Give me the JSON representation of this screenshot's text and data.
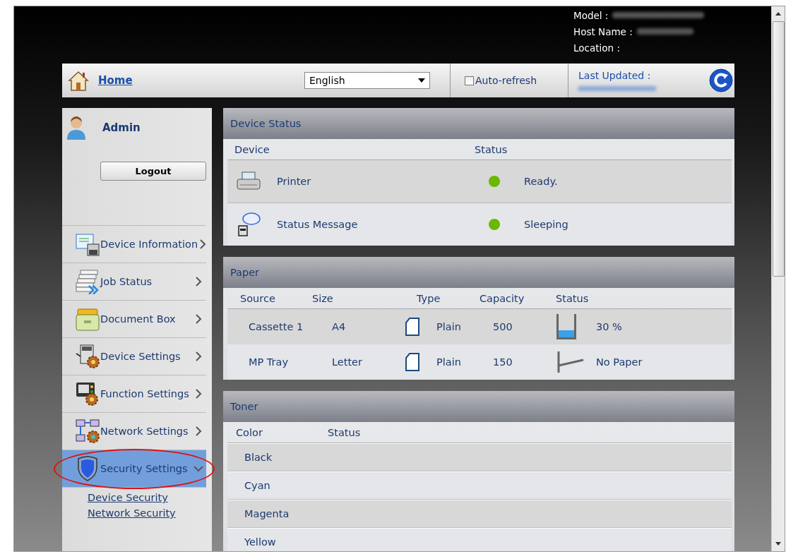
{
  "device_info": {
    "model_label": "Model :",
    "host_name_label": "Host Name :",
    "location_label": "Location :"
  },
  "toolbar": {
    "home_link": "Home",
    "language": "English",
    "auto_refresh": {
      "label": "Auto-refresh",
      "checked": false
    },
    "last_updated_label": "Last Updated :"
  },
  "sidebar": {
    "user": "Admin",
    "logout_button": "Logout",
    "items": [
      {
        "label": "Device Information",
        "kind": "info",
        "selected": false,
        "expanded": false
      },
      {
        "label": "Job Status",
        "kind": "jobs",
        "selected": false,
        "expanded": false
      },
      {
        "label": "Document Box",
        "kind": "box",
        "selected": false,
        "expanded": false
      },
      {
        "label": "Device Settings",
        "kind": "device",
        "selected": false,
        "expanded": false
      },
      {
        "label": "Function Settings",
        "kind": "function",
        "selected": false,
        "expanded": false
      },
      {
        "label": "Network Settings",
        "kind": "network",
        "selected": false,
        "expanded": false
      },
      {
        "label": "Security Settings",
        "kind": "security",
        "selected": true,
        "expanded": true
      }
    ],
    "sub_items": [
      "Device Security",
      "Network Security"
    ]
  },
  "device_status": {
    "title": "Device Status",
    "columns": [
      "Device",
      "Status"
    ],
    "rows": [
      {
        "kind": "printer",
        "device": "Printer",
        "status": "Ready.",
        "color": "#6ab800"
      },
      {
        "kind": "message",
        "device": "Status Message",
        "status": "Sleeping",
        "color": "#6ab800"
      }
    ]
  },
  "paper": {
    "title": "Paper",
    "columns": [
      "Source",
      "Size",
      "Type",
      "Capacity",
      "Status"
    ],
    "rows": [
      {
        "source": "Cassette 1",
        "size": "A4",
        "type": "Plain",
        "capacity": "500",
        "level": 0.3,
        "status": "30 %"
      },
      {
        "source": "MP Tray",
        "size": "Letter",
        "type": "Plain",
        "capacity": "150",
        "status": "No Paper"
      }
    ]
  },
  "toner": {
    "title": "Toner",
    "columns": [
      "Color",
      "Status"
    ],
    "rows": [
      "Black",
      "Cyan",
      "Magenta",
      "Yellow"
    ]
  }
}
